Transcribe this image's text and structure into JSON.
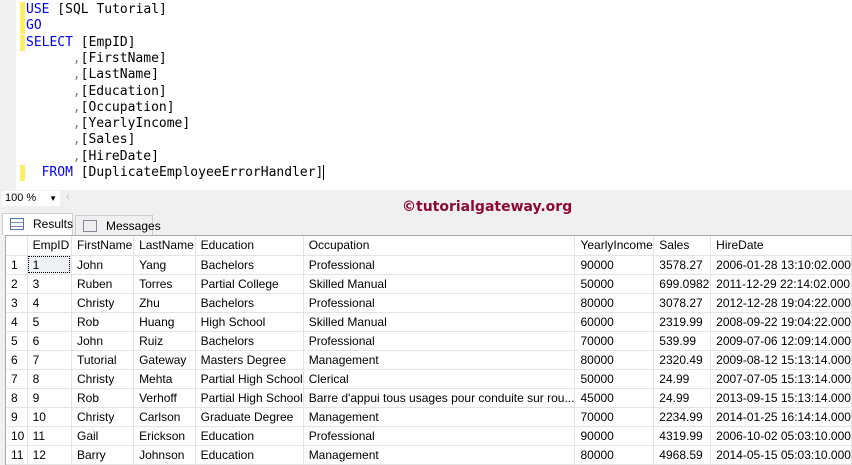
{
  "editor": {
    "lines": [
      {
        "parts": [
          {
            "t": "USE",
            "c": "kw"
          },
          {
            "t": " [SQL Tutorial]",
            "c": ""
          }
        ],
        "mark": true,
        "indent": 0
      },
      {
        "parts": [
          {
            "t": "GO",
            "c": "kw"
          }
        ],
        "mark": true,
        "indent": 0
      },
      {
        "parts": [
          {
            "t": "SELECT",
            "c": "kw"
          },
          {
            "t": " [EmpID]",
            "c": ""
          }
        ],
        "mark": true,
        "indent": 0
      },
      {
        "parts": [
          {
            "t": ",",
            "c": "op"
          },
          {
            "t": "[FirstName]",
            "c": ""
          }
        ],
        "mark": false,
        "indent": 6
      },
      {
        "parts": [
          {
            "t": ",",
            "c": "op"
          },
          {
            "t": "[LastName]",
            "c": ""
          }
        ],
        "mark": false,
        "indent": 6
      },
      {
        "parts": [
          {
            "t": ",",
            "c": "op"
          },
          {
            "t": "[Education]",
            "c": ""
          }
        ],
        "mark": false,
        "indent": 6
      },
      {
        "parts": [
          {
            "t": ",",
            "c": "op"
          },
          {
            "t": "[Occupation]",
            "c": ""
          }
        ],
        "mark": false,
        "indent": 6
      },
      {
        "parts": [
          {
            "t": ",",
            "c": "op"
          },
          {
            "t": "[YearlyIncome]",
            "c": ""
          }
        ],
        "mark": false,
        "indent": 6
      },
      {
        "parts": [
          {
            "t": ",",
            "c": "op"
          },
          {
            "t": "[Sales]",
            "c": ""
          }
        ],
        "mark": false,
        "indent": 6
      },
      {
        "parts": [
          {
            "t": ",",
            "c": "op"
          },
          {
            "t": "[HireDate]",
            "c": ""
          }
        ],
        "mark": false,
        "indent": 6
      },
      {
        "parts": [
          {
            "t": "FROM",
            "c": "kw"
          },
          {
            "t": " [DuplicateEmployeeErrorHandler]",
            "c": ""
          }
        ],
        "mark": true,
        "indent": 2,
        "cursor": true
      }
    ]
  },
  "zoom": {
    "value": "100 %"
  },
  "watermark": "©tutorialgateway.org",
  "tabs": {
    "results": "Results",
    "messages": "Messages"
  },
  "results": {
    "columns": [
      "",
      "EmpID",
      "FirstName",
      "LastName",
      "Education",
      "Occupation",
      "YearlyIncome",
      "Sales",
      "HireDate"
    ],
    "rows": [
      [
        "1",
        "1",
        "John",
        "Yang",
        "Bachelors",
        "Professional",
        "90000",
        "3578.27",
        "2006-01-28 13:10:02.000"
      ],
      [
        "2",
        "3",
        "Ruben",
        "Torres",
        "Partial College",
        "Skilled Manual",
        "50000",
        "699.0982",
        "2011-12-29 22:14:02.000"
      ],
      [
        "3",
        "4",
        "Christy",
        "Zhu",
        "Bachelors",
        "Professional",
        "80000",
        "3078.27",
        "2012-12-28 19:04:22.000"
      ],
      [
        "4",
        "5",
        "Rob",
        "Huang",
        "High School",
        "Skilled Manual",
        "60000",
        "2319.99",
        "2008-09-22 19:04:22.000"
      ],
      [
        "5",
        "6",
        "John",
        "Ruiz",
        "Bachelors",
        "Professional",
        "70000",
        "539.99",
        "2009-07-06 12:09:14.000"
      ],
      [
        "6",
        "7",
        "Tutorial",
        "Gateway",
        "Masters Degree",
        "Management",
        "80000",
        "2320.49",
        "2009-08-12 15:13:14.000"
      ],
      [
        "7",
        "8",
        "Christy",
        "Mehta",
        "Partial High School",
        "Clerical",
        "50000",
        "24.99",
        "2007-07-05 15:13:14.000"
      ],
      [
        "8",
        "9",
        "Rob",
        "Verhoff",
        "Partial High School",
        "Barre d'appui tous usages pour conduite sur rou...",
        "45000",
        "24.99",
        "2013-09-15 15:13:14.000"
      ],
      [
        "9",
        "10",
        "Christy",
        "Carlson",
        "Graduate Degree",
        "Management",
        "70000",
        "2234.99",
        "2014-01-25 16:14:14.000"
      ],
      [
        "10",
        "11",
        "Gail",
        "Erickson",
        "Education",
        "Professional",
        "90000",
        "4319.99",
        "2006-10-02 05:03:10.000"
      ],
      [
        "11",
        "12",
        "Barry",
        "Johnson",
        "Education",
        "Management",
        "80000",
        "4968.59",
        "2014-05-15 05:03:10.000"
      ]
    ]
  }
}
